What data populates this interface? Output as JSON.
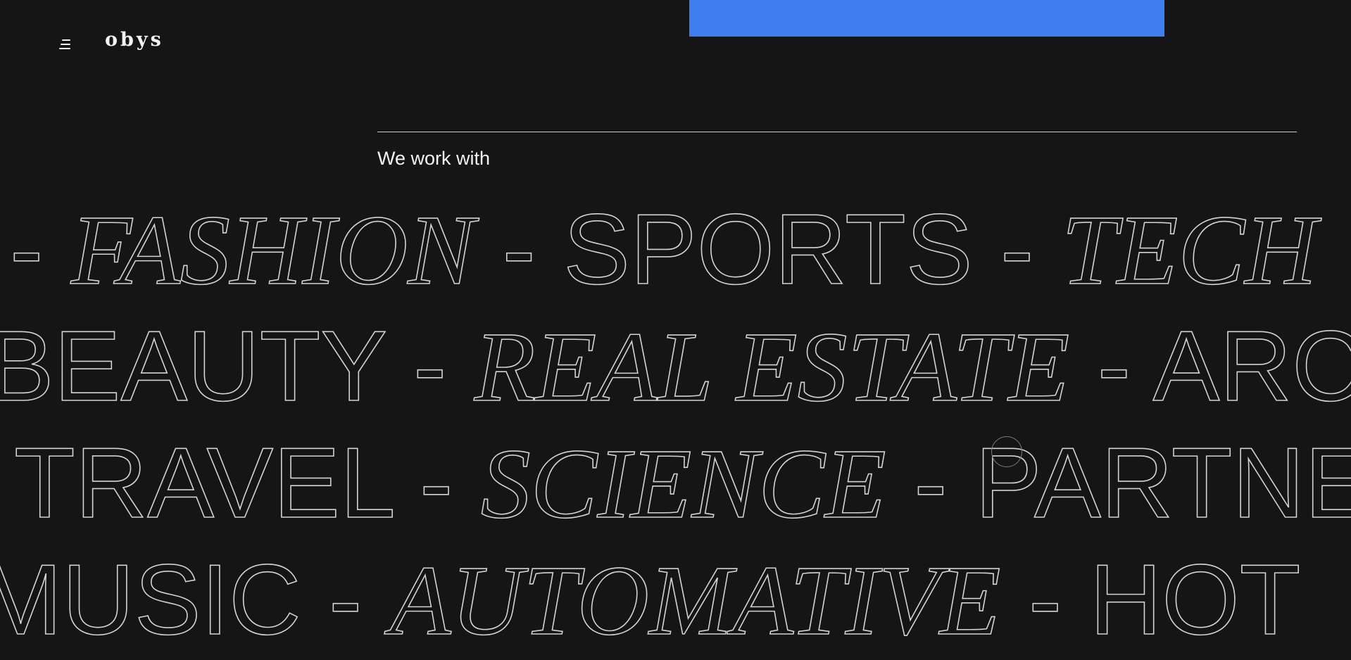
{
  "header": {
    "logo_text": "obys",
    "menu_icon": "hamburger-menu-icon"
  },
  "banner": {
    "accent_color": "#3f7ef0"
  },
  "section": {
    "label": "We work with"
  },
  "marquee": {
    "rows": [
      [
        {
          "text": "-",
          "style": "dash"
        },
        {
          "text": "FASHION",
          "style": "serif"
        },
        {
          "text": "-",
          "style": "dash"
        },
        {
          "text": "SPORTS",
          "style": "sans"
        },
        {
          "text": "-",
          "style": "dash"
        },
        {
          "text": "TECH",
          "style": "serif"
        }
      ],
      [
        {
          "text": "BEAUTY",
          "style": "sans"
        },
        {
          "text": "-",
          "style": "dash"
        },
        {
          "text": "REAL ESTATE",
          "style": "serif"
        },
        {
          "text": "-",
          "style": "dash"
        },
        {
          "text": "ARC",
          "style": "sans"
        }
      ],
      [
        {
          "text": "TRAVEL",
          "style": "sans"
        },
        {
          "text": "-",
          "style": "dash"
        },
        {
          "text": "SCIENCE",
          "style": "serif"
        },
        {
          "text": "-",
          "style": "dash"
        },
        {
          "text": "PARTNE",
          "style": "sans"
        }
      ],
      [
        {
          "text": "MUSIC",
          "style": "sans"
        },
        {
          "text": "-",
          "style": "dash"
        },
        {
          "text": "AUTOMATIVE",
          "style": "serif"
        },
        {
          "text": "-",
          "style": "dash"
        },
        {
          "text": "HOT",
          "style": "sans"
        }
      ]
    ]
  }
}
